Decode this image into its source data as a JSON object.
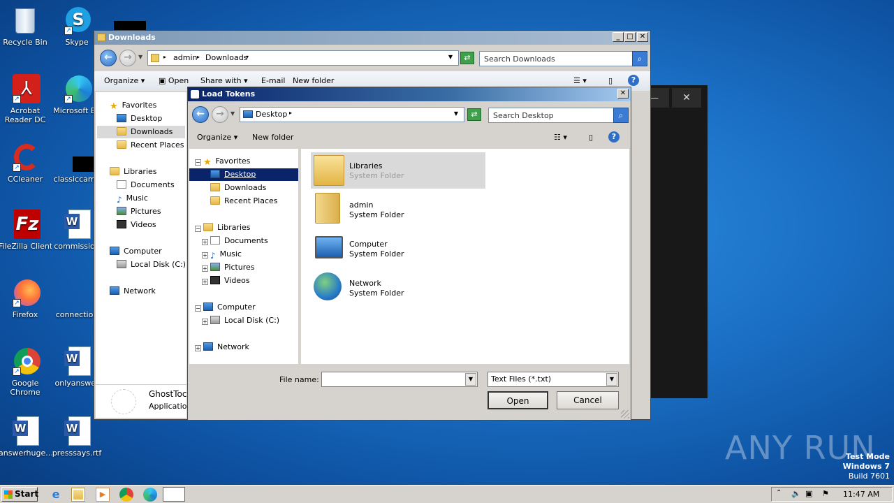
{
  "desktop": {
    "icons": [
      {
        "label": "Recycle Bin"
      },
      {
        "label": "Skype"
      },
      {
        "label": "Acrobat Reader DC"
      },
      {
        "label": "Microsoft Ed"
      },
      {
        "label": "CCleaner"
      },
      {
        "label": "classiccame"
      },
      {
        "label": "FileZilla Client"
      },
      {
        "label": "commission"
      },
      {
        "label": "Firefox"
      },
      {
        "label": "connection"
      },
      {
        "label": "Google Chrome"
      },
      {
        "label": "onlyanswer"
      },
      {
        "label": "answerhuge..."
      },
      {
        "label": "presssays.rtf"
      }
    ],
    "watermark": "ANY RUN",
    "test_mode": {
      "line1": "Test Mode",
      "line2": "Windows 7",
      "line3": "Build 7601"
    }
  },
  "downloads_window": {
    "title": "Downloads",
    "breadcrumb": [
      "admin",
      "Downloads"
    ],
    "search_placeholder": "Search Downloads",
    "toolbar": {
      "organize": "Organize",
      "open": "Open",
      "share_with": "Share with",
      "email": "E-mail",
      "new_folder": "New folder"
    },
    "nav": [
      {
        "label": "Favorites"
      },
      {
        "label": "Desktop"
      },
      {
        "label": "Downloads"
      },
      {
        "label": "Recent Places"
      },
      {
        "label": "Libraries"
      },
      {
        "label": "Documents"
      },
      {
        "label": "Music"
      },
      {
        "label": "Pictures"
      },
      {
        "label": "Videos"
      },
      {
        "label": "Computer"
      },
      {
        "label": "Local Disk (C:)"
      },
      {
        "label": "Network"
      }
    ],
    "details_name": "GhostToc",
    "details_type": "Application"
  },
  "dialog": {
    "title": "Load Tokens",
    "location": "Desktop",
    "search_placeholder": "Search Desktop",
    "toolbar": {
      "organize": "Organize",
      "new_folder": "New folder"
    },
    "tree": [
      {
        "label": "Favorites"
      },
      {
        "label": "Desktop"
      },
      {
        "label": "Downloads"
      },
      {
        "label": "Recent Places"
      },
      {
        "label": "Libraries"
      },
      {
        "label": "Documents"
      },
      {
        "label": "Music"
      },
      {
        "label": "Pictures"
      },
      {
        "label": "Videos"
      },
      {
        "label": "Computer"
      },
      {
        "label": "Local Disk (C:)"
      },
      {
        "label": "Network"
      }
    ],
    "items": [
      {
        "name": "Libraries",
        "type": "System Folder"
      },
      {
        "name": "admin",
        "type": "System Folder"
      },
      {
        "name": "Computer",
        "type": "System Folder"
      },
      {
        "name": "Network",
        "type": "System Folder"
      }
    ],
    "file_name_label": "File name:",
    "file_name_value": "",
    "file_type": "Text Files (*.txt)",
    "open_label": "Open",
    "cancel_label": "Cancel"
  },
  "dark_window": {
    "minimize": "—",
    "close": "✕"
  },
  "taskbar": {
    "start": "Start",
    "clock": "11:47 AM"
  }
}
